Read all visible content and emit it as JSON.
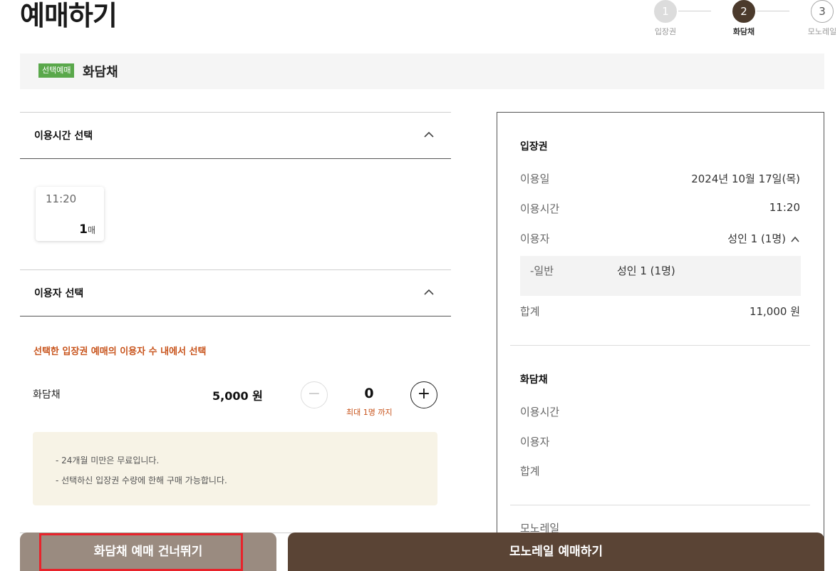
{
  "page": {
    "title": "예매하기"
  },
  "stepper": {
    "steps": [
      {
        "num": "1",
        "label": "입장권",
        "state": "done"
      },
      {
        "num": "2",
        "label": "화담채",
        "state": "active"
      },
      {
        "num": "3",
        "label": "모노레일",
        "state": "todo"
      }
    ]
  },
  "banner": {
    "badge": "선택예매",
    "title": "화담채"
  },
  "time_section": {
    "title": "이용시간 선택",
    "slot": {
      "time": "11:20",
      "count": "1",
      "unit": "매"
    }
  },
  "user_section": {
    "title": "이용자 선택",
    "notice": "선택한 입장권 예매의 이용자 수 내에서 선택",
    "item": {
      "label": "화담채",
      "price": "5,000 원",
      "qty": "0",
      "max_note": "최대 1명 까지",
      "minus": "−",
      "plus": "+"
    },
    "info": [
      "-  24개월 미만은 무료입니다.",
      "-  선택하신 입장권 수량에 한해 구매 가능합니다."
    ]
  },
  "summary": {
    "ticket": {
      "title": "입장권",
      "date_label": "이용일",
      "date_value": "2024년 10월 17일(목)",
      "time_label": "이용시간",
      "time_value": "11:20",
      "user_label": "이용자",
      "user_value": "성인 1 (1명)",
      "sub_label": "-일반",
      "sub_value": "성인 1 (1명)",
      "total_label": "합계",
      "total_value": "11,000 원"
    },
    "hwadamchae": {
      "title": "화담채",
      "time_label": "이용시간",
      "user_label": "이용자",
      "total_label": "합계"
    },
    "monorail": {
      "title": "모노레일"
    }
  },
  "buttons": {
    "skip": "화담채 예매 건너뛰기",
    "monorail": "모노레일 예매하기"
  },
  "colors": {
    "accent_orange": "#c8541c",
    "badge_green": "#5aa84b",
    "brown_dark": "#5a4435",
    "brown_light": "#9a8b80",
    "highlight_red": "#e8232b"
  }
}
